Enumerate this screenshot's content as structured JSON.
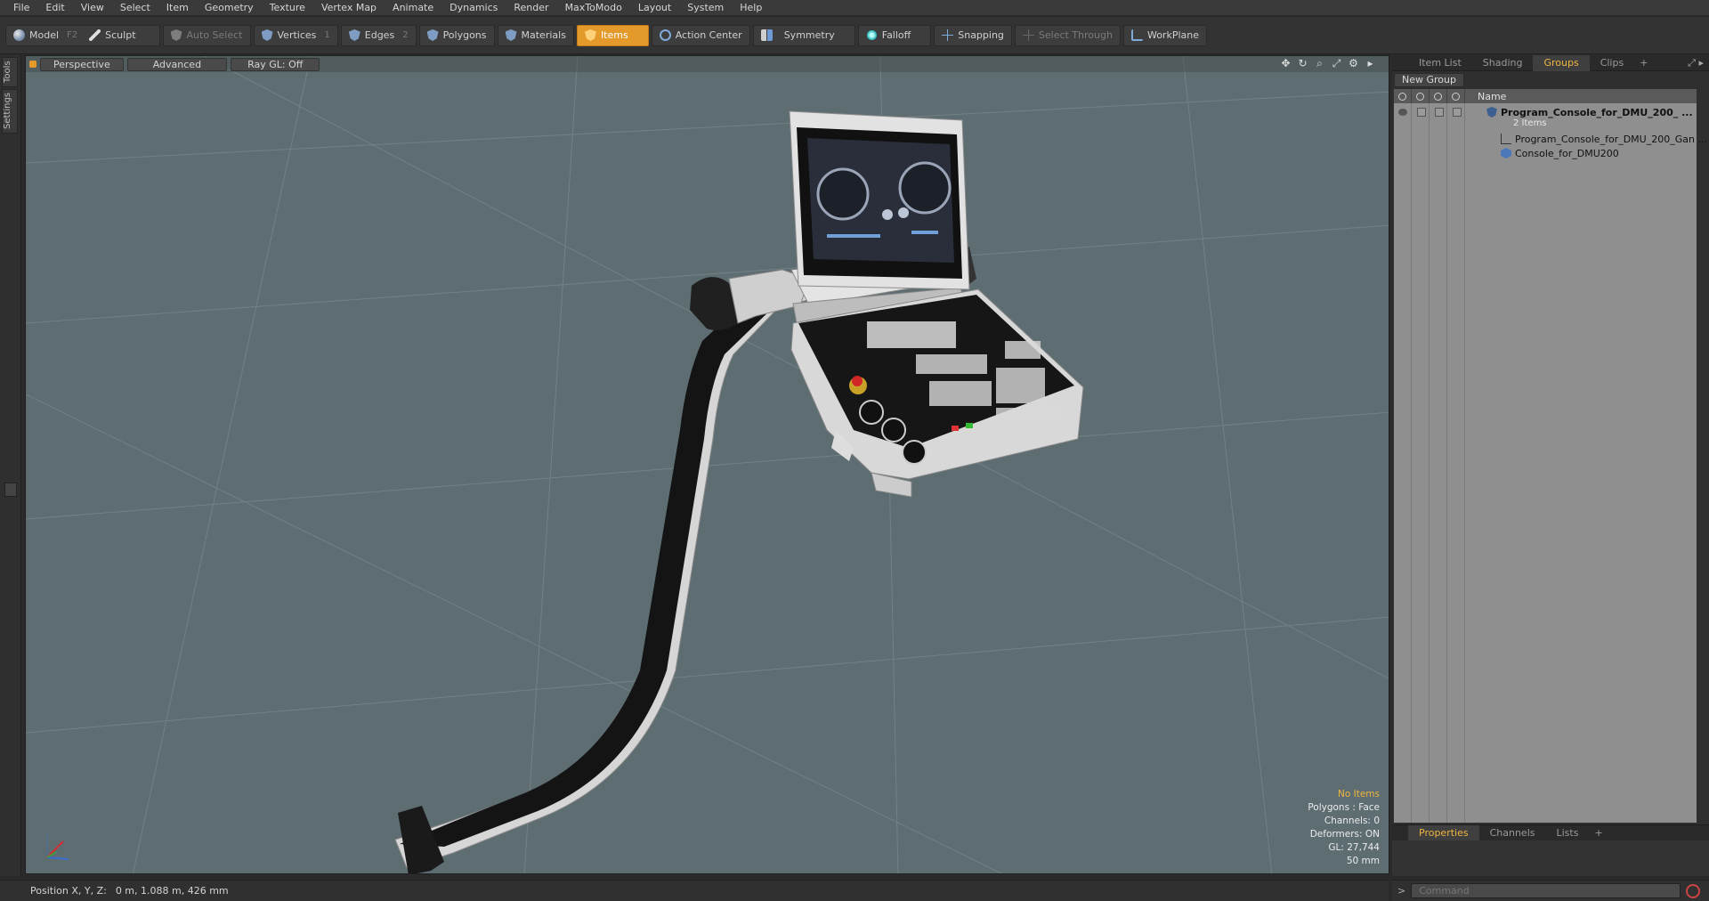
{
  "menu": [
    "File",
    "Edit",
    "View",
    "Select",
    "Item",
    "Geometry",
    "Texture",
    "Vertex Map",
    "Animate",
    "Dynamics",
    "Render",
    "MaxToModo",
    "Layout",
    "System",
    "Help"
  ],
  "toolbar": {
    "model_label": "Model",
    "model_key": "F2",
    "sculpt_label": "Sculpt",
    "auto_select_label": "Auto Select",
    "vertices_label": "Vertices",
    "vertices_key": "1",
    "edges_label": "Edges",
    "edges_key": "2",
    "polygons_label": "Polygons",
    "materials_label": "Materials",
    "items_label": "Items",
    "action_center_label": "Action Center",
    "symmetry_label": "Symmetry",
    "falloff_label": "Falloff",
    "snapping_label": "Snapping",
    "select_through_label": "Select Through",
    "workplane_label": "WorkPlane"
  },
  "left_tabs": [
    "Tools",
    "Settings"
  ],
  "viewport": {
    "view_label": "Perspective",
    "mode_label": "Advanced",
    "raygl_label": "Ray GL: Off",
    "stats": {
      "selection": "No Items",
      "polygons": "Polygons : Face",
      "channels": "Channels: 0",
      "deformers": "Deformers: ON",
      "gl": "GL: 27,744",
      "scale": "50 mm"
    }
  },
  "right_panel": {
    "tabs": [
      "Item List",
      "Shading",
      "Groups",
      "Clips"
    ],
    "active_tab": "Groups",
    "add_tab": "+",
    "new_group_label": "New Group",
    "column_name": "Name",
    "group": {
      "name": "Program_Console_for_DMU_200_ ...",
      "count": "2 Items",
      "children": [
        "Program_Console_for_DMU_200_Gan ...",
        "Console_for_DMU200"
      ]
    },
    "bottom_tabs": [
      "Properties",
      "Channels",
      "Lists"
    ],
    "bottom_active": "Properties"
  },
  "status": {
    "position_label": "Position X, Y, Z:",
    "position_value": "0 m, 1.088 m, 426 mm"
  },
  "command": {
    "placeholder": "Command"
  },
  "colors": {
    "accent": "#e39a2b",
    "viewport_bg": "#5d6d72",
    "panel_bg": "#2f2f2f"
  }
}
